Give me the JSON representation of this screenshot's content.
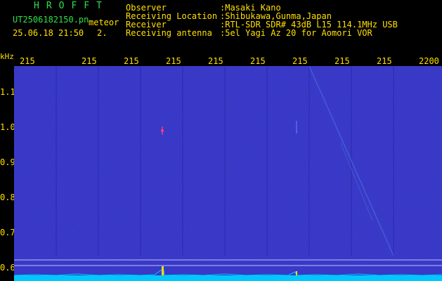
{
  "header": {
    "brand": "HROFFT",
    "file_name": "UT2506182150.pn",
    "file_suffix": "meteor",
    "timestamp": "25.06.18 21:50",
    "index": "2.",
    "fields": [
      {
        "label": "Observer",
        "value": ":Masaki Kano"
      },
      {
        "label": "Receiving Location",
        "value": ":Shibukawa,Gunma,Japan"
      },
      {
        "label": "Receiver",
        "value": ":RTL-SDR SDR# 43dB L15 114.1MHz USB"
      },
      {
        "label": "Receiving antenna",
        "value": ":5el Yagi Az 20 for Aomori VOR"
      }
    ]
  },
  "axis": {
    "y_unit": "kHz",
    "y_ticks": [
      "1.1",
      "1.0",
      "0.9",
      "0.8",
      "0.7",
      "0.6"
    ],
    "x_ticks": [
      "215",
      "215",
      "215",
      "215",
      "215",
      "215",
      "215",
      "215",
      "215",
      "2200"
    ]
  },
  "colors": {
    "background": "#000000",
    "waterfall": "#0a0a6e",
    "label_yellow": "#ffe000",
    "brand_green": "#2fe04a",
    "signal_cyan": "#00c8ff"
  }
}
